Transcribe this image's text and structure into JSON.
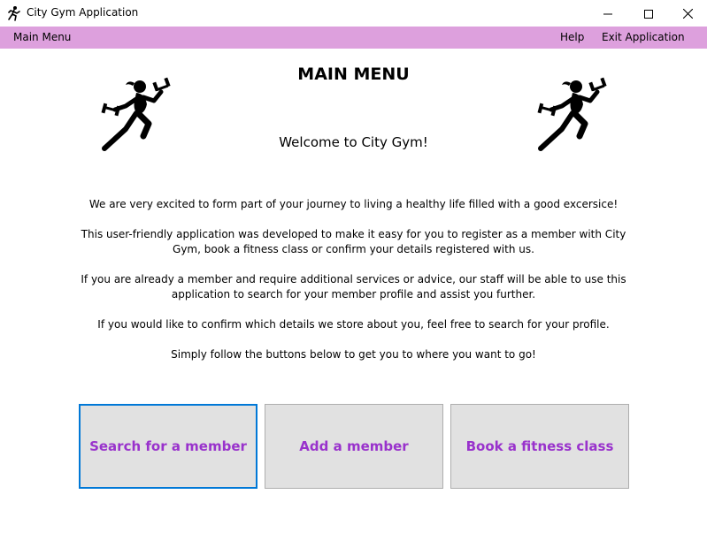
{
  "window": {
    "title": "City Gym Application",
    "icons": {
      "app": "runner-icon",
      "minimize": "minimize-icon",
      "maximize": "maximize-icon",
      "close": "close-icon"
    }
  },
  "menubar": {
    "background": "#dda0dd",
    "main_menu": "Main Menu",
    "help": "Help",
    "exit": "Exit Application"
  },
  "main": {
    "heading": "MAIN MENU",
    "welcome": "Welcome to City Gym!",
    "paragraphs": [
      "We are very excited to form part of your journey to living a healthy life filled with a good excersice!",
      "This user-friendly application was developed to make it easy for you to register as a member with City Gym, book a fitness class or confirm your details registered with us.",
      "If you are already a member and require additional services or advice, our staff will be able to use this application to search for your member profile and assist you further.",
      "If you would like to confirm which details we store about you, feel free to search for your profile.",
      "Simply follow the buttons below to get you to where you want to go!"
    ],
    "images": [
      "runner-dumbbell-icon",
      "runner-dumbbell-icon"
    ]
  },
  "buttons": {
    "search_member": "Search for a member",
    "add_member": "Add a member",
    "book_class": "Book a fitness class",
    "text_color": "#9932cc",
    "focus_border": "#0078d7"
  }
}
